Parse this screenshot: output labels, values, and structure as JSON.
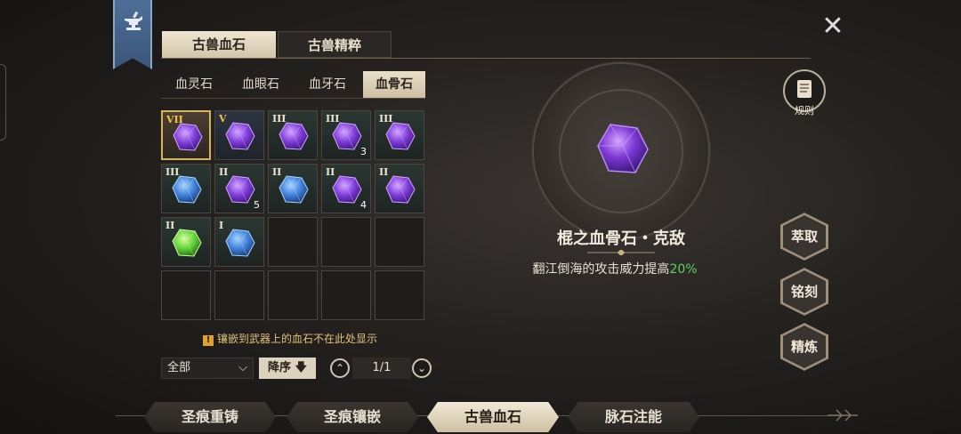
{
  "main_tabs": [
    {
      "label": "古兽血石",
      "active": true
    },
    {
      "label": "古兽精粹",
      "active": false
    }
  ],
  "sub_tabs": [
    {
      "label": "血灵石",
      "active": false
    },
    {
      "label": "血眼石",
      "active": false
    },
    {
      "label": "血牙石",
      "active": false
    },
    {
      "label": "血骨石",
      "active": true
    }
  ],
  "grid": [
    {
      "tier": "VII",
      "color": "purple",
      "count": "",
      "selected": true,
      "tier_gold": false
    },
    {
      "tier": "V",
      "color": "purple",
      "count": "",
      "selected": false,
      "tier_gold": true
    },
    {
      "tier": "III",
      "color": "purple",
      "count": "",
      "selected": false,
      "tier_gold": false
    },
    {
      "tier": "III",
      "color": "purple",
      "count": "3",
      "selected": false,
      "tier_gold": false
    },
    {
      "tier": "III",
      "color": "purple",
      "count": "",
      "selected": false,
      "tier_gold": false
    },
    {
      "tier": "III",
      "color": "blue",
      "count": "",
      "selected": false,
      "tier_gold": false
    },
    {
      "tier": "II",
      "color": "purple",
      "count": "5",
      "selected": false,
      "tier_gold": false
    },
    {
      "tier": "II",
      "color": "blue",
      "count": "",
      "selected": false,
      "tier_gold": false
    },
    {
      "tier": "II",
      "color": "purple",
      "count": "4",
      "selected": false,
      "tier_gold": false
    },
    {
      "tier": "II",
      "color": "purple",
      "count": "",
      "selected": false,
      "tier_gold": false
    },
    {
      "tier": "II",
      "color": "green",
      "count": "",
      "selected": false,
      "tier_gold": false
    },
    {
      "tier": "I",
      "color": "blue",
      "count": "",
      "selected": false,
      "tier_gold": false
    },
    null,
    null,
    null,
    null,
    null,
    null,
    null,
    null
  ],
  "notice": "镶嵌到武器上的血石不在此处显示",
  "notice_icon": "!",
  "filter": {
    "value": "全部",
    "chevron": "⌵"
  },
  "sort": {
    "label": "降序",
    "arrow": "🡇"
  },
  "pager": {
    "text": "1/1",
    "prev": "⌃",
    "next": "⌄"
  },
  "detail": {
    "name": "棍之血骨石・克敌",
    "desc_prefix": "翻江倒海的攻击威力提高",
    "desc_value": "20%"
  },
  "rules_label": "规则",
  "actions": [
    {
      "label": "萃取"
    },
    {
      "label": "铭刻"
    },
    {
      "label": "精炼"
    }
  ],
  "bottom_tabs": [
    {
      "label": "圣痕重铸",
      "active": false
    },
    {
      "label": "圣痕镶嵌",
      "active": false
    },
    {
      "label": "古兽血石",
      "active": true
    },
    {
      "label": "脉石注能",
      "active": false
    }
  ],
  "close_icon": "✕",
  "colors": {
    "purple": "#8a4bd6",
    "blue": "#3f7fd8",
    "green": "#5fcf3a",
    "gold_border": "#d7b35c",
    "accent_green": "#5fd35a"
  }
}
